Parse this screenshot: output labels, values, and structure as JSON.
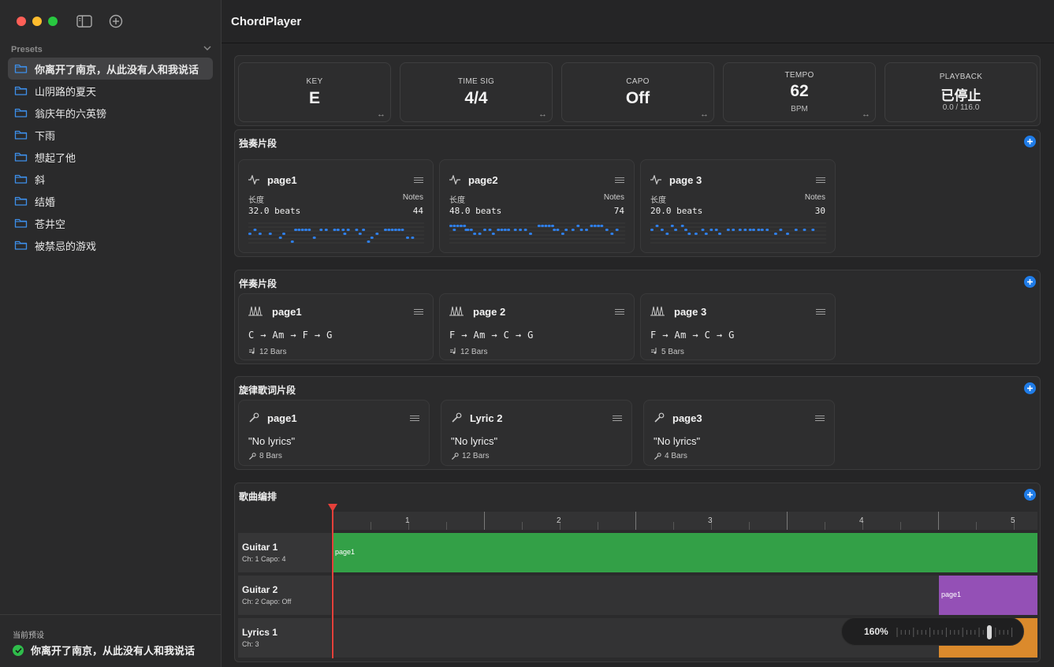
{
  "sidebar": {
    "section_title": "Presets",
    "items": [
      {
        "label": "你离开了南京，从此没有人和我说话",
        "selected": true
      },
      {
        "label": "山阴路的夏天"
      },
      {
        "label": "翁庆年的六英镑"
      },
      {
        "label": "下雨"
      },
      {
        "label": "想起了他"
      },
      {
        "label": "斜"
      },
      {
        "label": "结婚"
      },
      {
        "label": "苍井空"
      },
      {
        "label": "被禁忌的游戏"
      }
    ],
    "footer_label": "当前预设",
    "current_preset": "你离开了南京，从此没有人和我说话"
  },
  "app": {
    "title": "ChordPlayer"
  },
  "stats": {
    "key": {
      "label": "KEY",
      "value": "E"
    },
    "time_sig": {
      "label": "TIME SIG",
      "value": "4/4"
    },
    "capo": {
      "label": "CAPO",
      "value": "Off"
    },
    "tempo": {
      "label": "TEMPO",
      "value": "62",
      "unit": "BPM"
    },
    "playback": {
      "label": "PLAYBACK",
      "value": "已停止",
      "position": "0.0 / 116.0"
    }
  },
  "solo": {
    "title": "独奏片段",
    "length_label": "长度",
    "notes_label": "Notes",
    "clips": [
      {
        "name": "page1",
        "length": "32.0 beats",
        "notes": "44"
      },
      {
        "name": "page2",
        "length": "48.0 beats",
        "notes": "74"
      },
      {
        "name": "page 3",
        "length": "20.0 beats",
        "notes": "30"
      }
    ]
  },
  "accompaniment": {
    "title": "伴奏片段",
    "clips": [
      {
        "name": "page1",
        "chords": "C → Am → F → G",
        "bars": "12 Bars"
      },
      {
        "name": "page 2",
        "chords": "F → Am → C → G",
        "bars": "12 Bars"
      },
      {
        "name": "page 3",
        "chords": "F → Am → C → G",
        "bars": "5 Bars"
      }
    ]
  },
  "melody": {
    "title": "旋律歌词片段",
    "clips": [
      {
        "name": "page1",
        "lyrics": "\"No lyrics\"",
        "bars": "8 Bars"
      },
      {
        "name": "Lyric 2",
        "lyrics": "\"No lyrics\"",
        "bars": "12 Bars"
      },
      {
        "name": "page3",
        "lyrics": "\"No lyrics\"",
        "bars": "4 Bars"
      }
    ]
  },
  "arrangement": {
    "title": "歌曲编排",
    "ruler": [
      "1",
      "2",
      "3",
      "4",
      "5"
    ],
    "tracks": [
      {
        "name": "Guitar 1",
        "info": "Ch: 1   Capo: 4",
        "block": "page1",
        "color": "#33a047"
      },
      {
        "name": "Guitar 2",
        "info": "Ch: 2   Capo: Off",
        "block": "page1",
        "color": "#9450b6"
      },
      {
        "name": "Lyrics 1",
        "info": "Ch: 3",
        "block": "page1",
        "color": "#db8a2c"
      }
    ],
    "zoom": "160%"
  },
  "colors": {
    "accent": "#1f7ce8",
    "playhead": "#e5403a",
    "note": "#2f7fea"
  }
}
